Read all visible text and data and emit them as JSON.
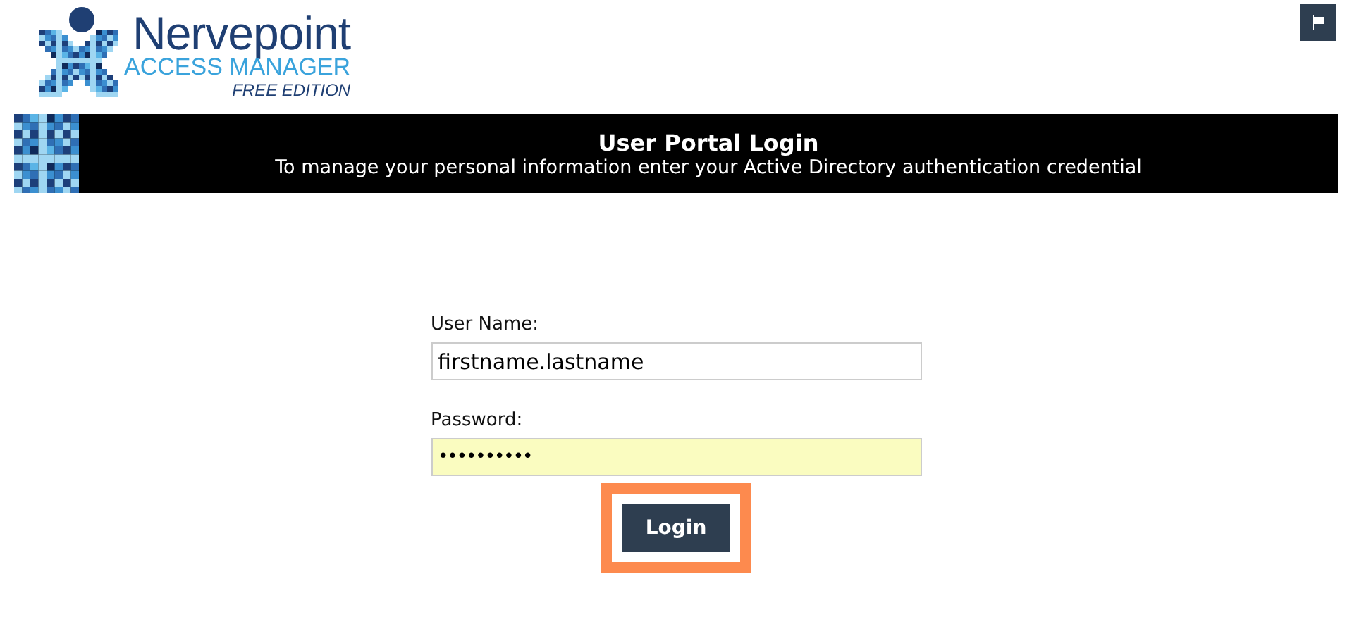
{
  "logo": {
    "name": "Nervepoint",
    "product": "ACCESS MANAGER",
    "edition": "FREE EDITION"
  },
  "banner": {
    "title": "User Portal Login",
    "subtitle": "To manage your personal information enter your Active Directory authentication credential"
  },
  "form": {
    "fields": [
      {
        "label": "User Name:",
        "value": "firstname.lastname",
        "kind": "text",
        "autofilled": false
      },
      {
        "label": "Password:",
        "value": "••••••••••",
        "kind": "password",
        "autofilled": true
      }
    ],
    "button": {
      "label": "Login",
      "highlighted": true
    }
  }
}
